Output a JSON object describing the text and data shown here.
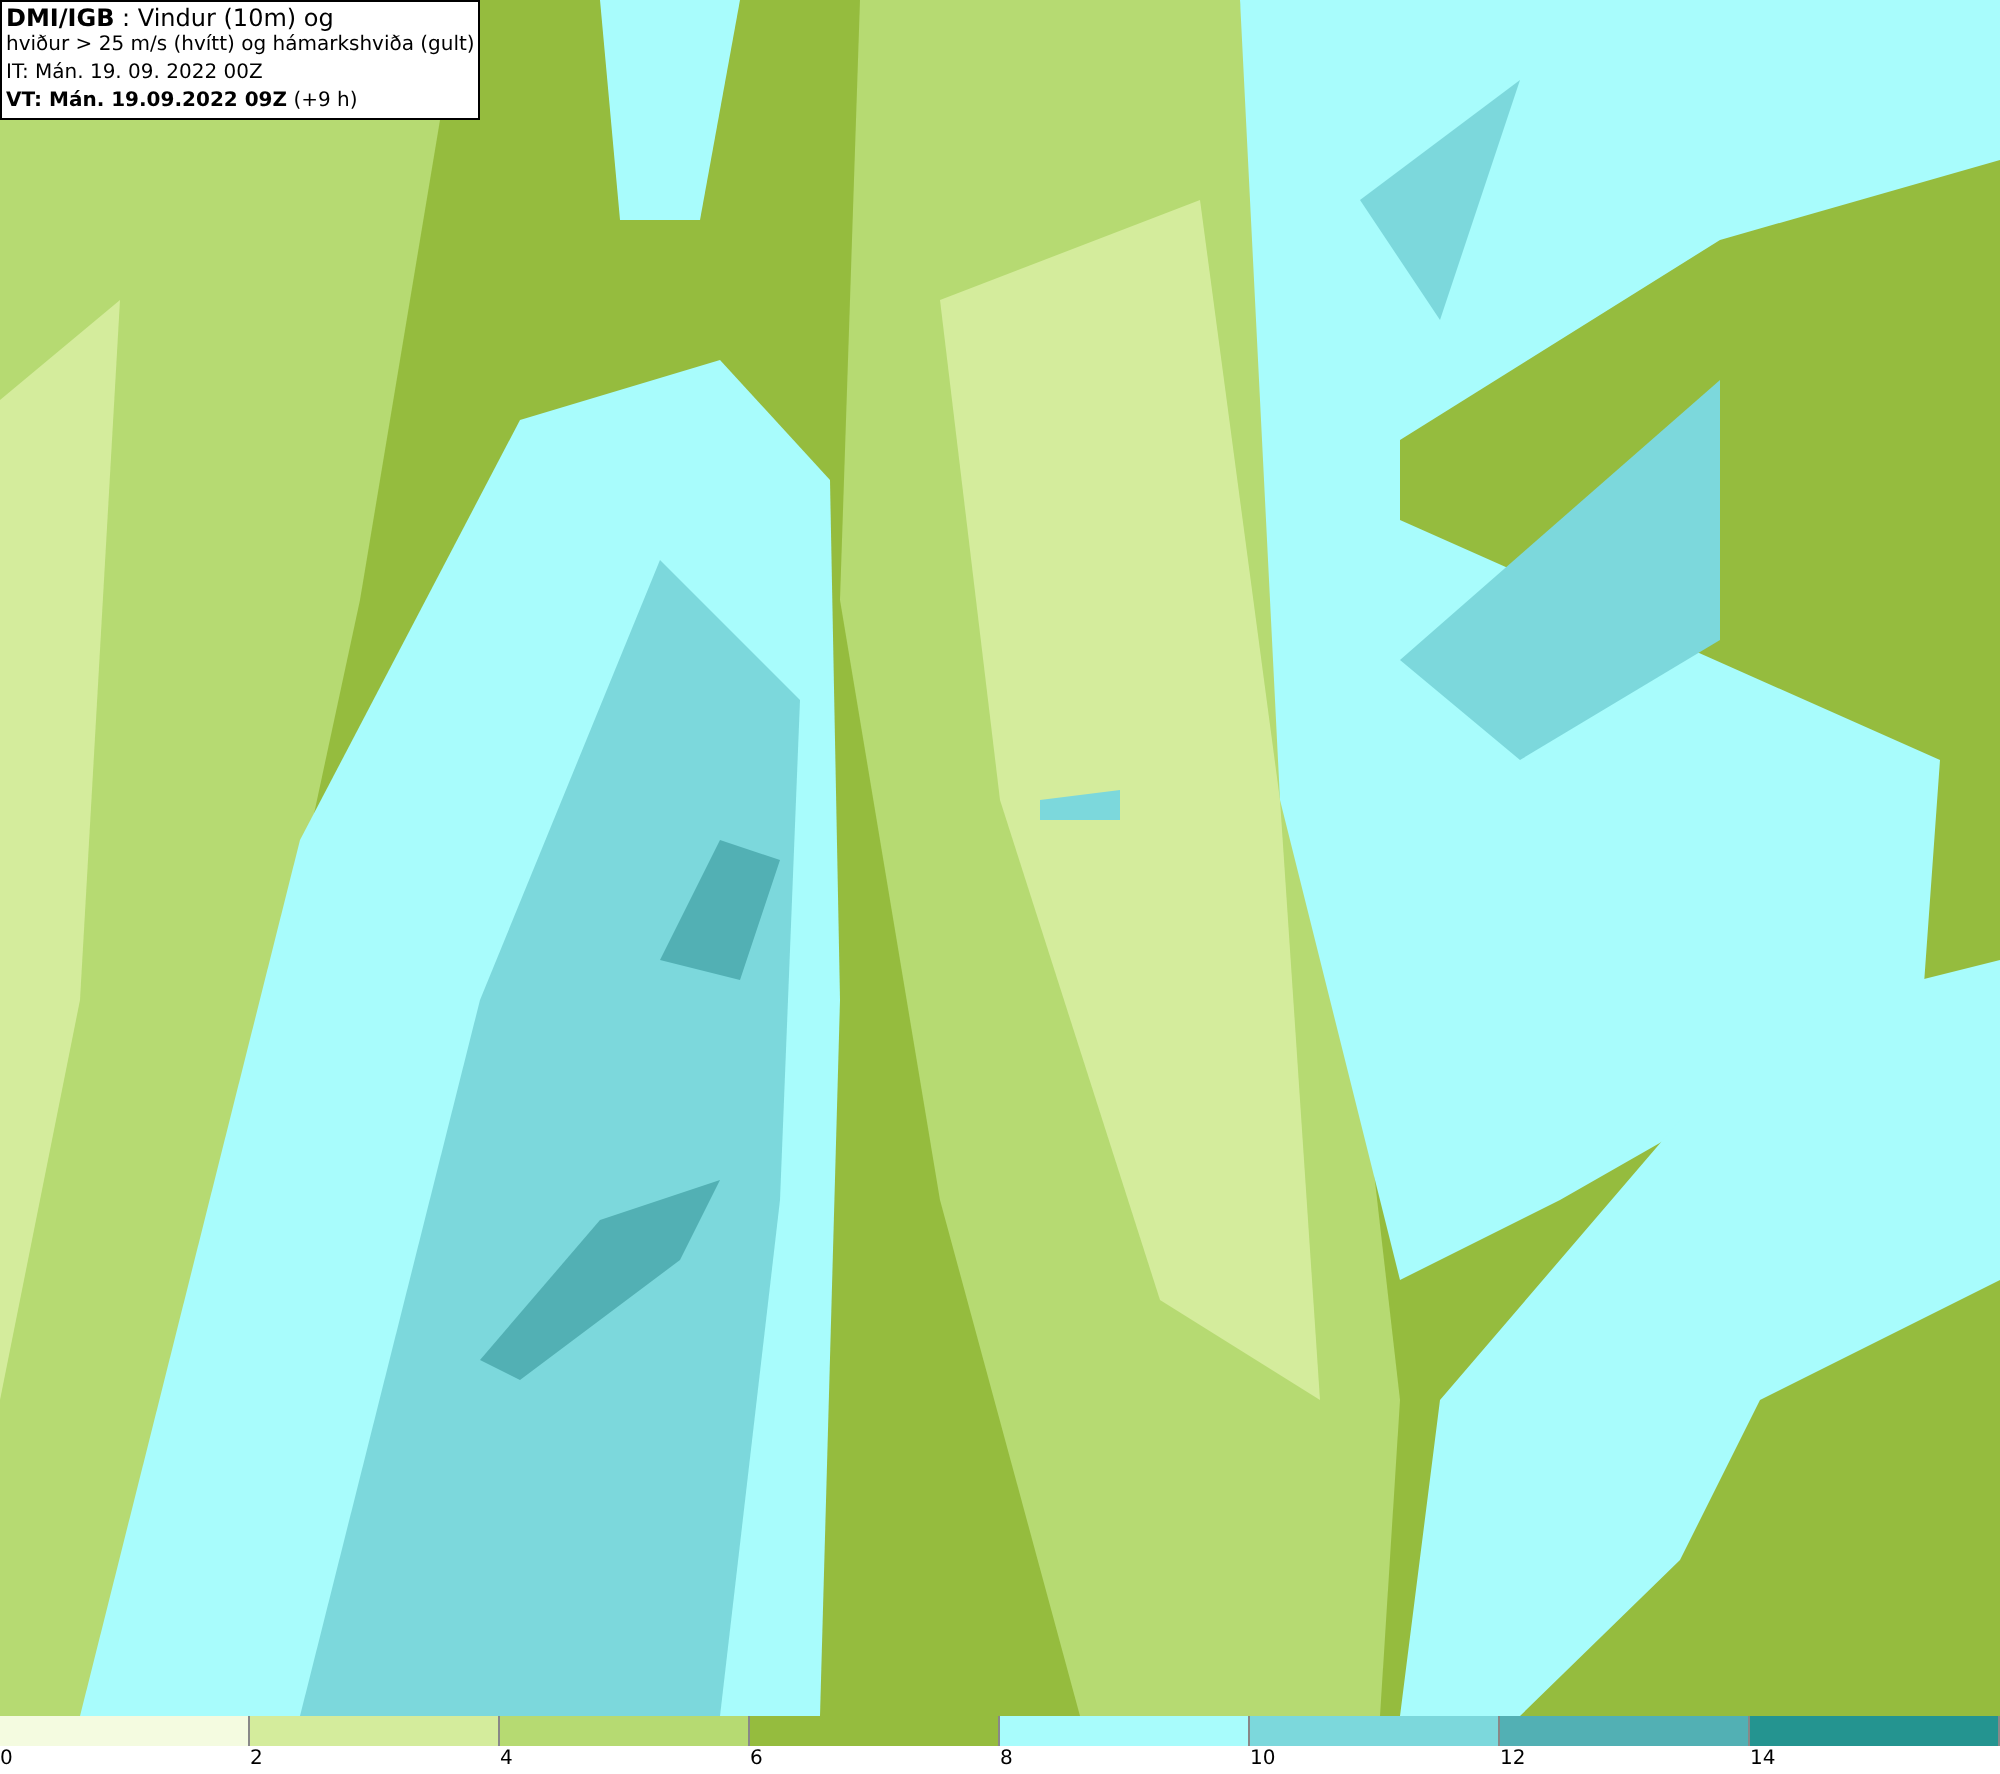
{
  "info_box": {
    "lines": [
      "**DMI/IGB** : Vindur (10m) og",
      "hviður > 25 m/s (hvítt) og hámarkshviða (gult)",
      "IT: Mán. 19. 09. 2022 00Z",
      "**VT: Mán. 19.09.2022 09Z** (+9 h)"
    ]
  },
  "legend": [
    {
      "label": "0",
      "color": "#f4fbe0"
    },
    {
      "label": "2",
      "color": "#d4ec9c"
    },
    {
      "label": "4",
      "color": "#b6da72"
    },
    {
      "label": "6",
      "color": "#95bc3e"
    },
    {
      "label": "8",
      "color": "#a8fcfc"
    },
    {
      "label": "10",
      "color": "#7cd8dc"
    },
    {
      "label": "12",
      "color": "#52b0b4"
    },
    {
      "label": "14",
      "color": "#249490"
    }
  ]
}
